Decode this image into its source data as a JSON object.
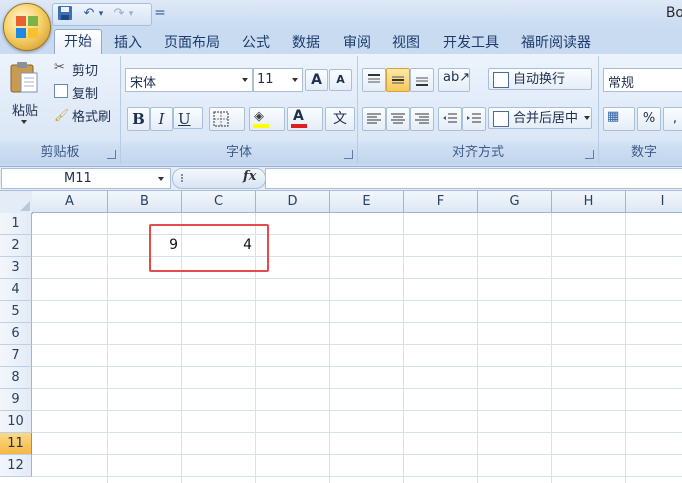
{
  "title": {
    "app_title_partial": "Bo"
  },
  "qat": {
    "undo_label": "↶",
    "redo_label": "↷",
    "customize_label": "="
  },
  "tabs": [
    "开始",
    "插入",
    "页面布局",
    "公式",
    "数据",
    "审阅",
    "视图",
    "开发工具",
    "福昕阅读器"
  ],
  "clipboard": {
    "paste": "粘贴",
    "cut": "剪切",
    "copy": "复制",
    "format_painter": "格式刷",
    "group_label": "剪贴板"
  },
  "font": {
    "font_name": "宋体",
    "font_size": "11",
    "grow": "A",
    "shrink": "A",
    "bold": "B",
    "italic": "I",
    "underline": "U",
    "font_color_letter": "A",
    "phonetic": "文",
    "group_label": "字体"
  },
  "alignment": {
    "wrap_text": "自动换行",
    "merge_center": "合并后居中",
    "group_label": "对齐方式"
  },
  "number": {
    "format": "常规",
    "percent": "%",
    "group_label": "数字"
  },
  "formula_bar": {
    "name_box": "M11",
    "fx_label": "fx",
    "formula": ""
  },
  "grid": {
    "columns": [
      "A",
      "B",
      "C",
      "D",
      "E",
      "F",
      "G",
      "H",
      "I"
    ],
    "rows": [
      "1",
      "2",
      "3",
      "4",
      "5",
      "6",
      "7",
      "8",
      "9",
      "10",
      "11",
      "12"
    ],
    "selected_row": "11",
    "cells": {
      "B2": "9",
      "C2": "4"
    }
  },
  "colors": {
    "highlight_border": "#e64a4a",
    "selected_row_header": "#f5b745",
    "font_color_bar": "#e02020",
    "highlight_color_bar": "#ffff00"
  }
}
